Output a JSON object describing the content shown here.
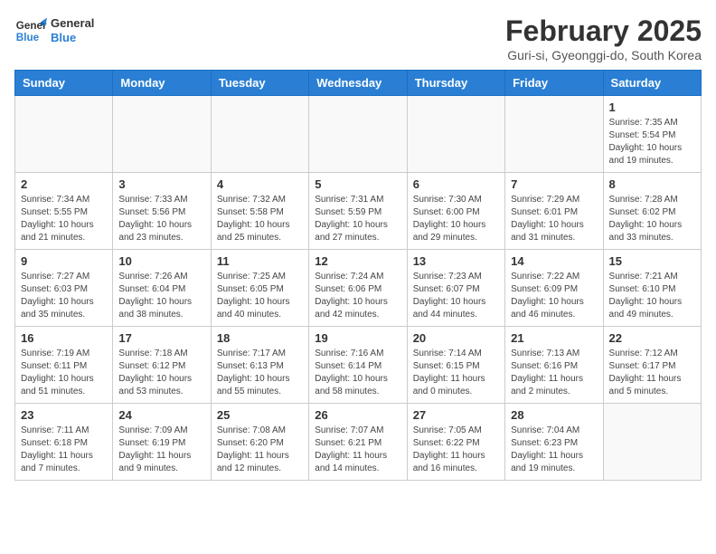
{
  "header": {
    "logo_line1": "General",
    "logo_line2": "Blue",
    "month_year": "February 2025",
    "location": "Guri-si, Gyeonggi-do, South Korea"
  },
  "weekdays": [
    "Sunday",
    "Monday",
    "Tuesday",
    "Wednesday",
    "Thursday",
    "Friday",
    "Saturday"
  ],
  "weeks": [
    [
      {
        "day": "",
        "info": ""
      },
      {
        "day": "",
        "info": ""
      },
      {
        "day": "",
        "info": ""
      },
      {
        "day": "",
        "info": ""
      },
      {
        "day": "",
        "info": ""
      },
      {
        "day": "",
        "info": ""
      },
      {
        "day": "1",
        "info": "Sunrise: 7:35 AM\nSunset: 5:54 PM\nDaylight: 10 hours\nand 19 minutes."
      }
    ],
    [
      {
        "day": "2",
        "info": "Sunrise: 7:34 AM\nSunset: 5:55 PM\nDaylight: 10 hours\nand 21 minutes."
      },
      {
        "day": "3",
        "info": "Sunrise: 7:33 AM\nSunset: 5:56 PM\nDaylight: 10 hours\nand 23 minutes."
      },
      {
        "day": "4",
        "info": "Sunrise: 7:32 AM\nSunset: 5:58 PM\nDaylight: 10 hours\nand 25 minutes."
      },
      {
        "day": "5",
        "info": "Sunrise: 7:31 AM\nSunset: 5:59 PM\nDaylight: 10 hours\nand 27 minutes."
      },
      {
        "day": "6",
        "info": "Sunrise: 7:30 AM\nSunset: 6:00 PM\nDaylight: 10 hours\nand 29 minutes."
      },
      {
        "day": "7",
        "info": "Sunrise: 7:29 AM\nSunset: 6:01 PM\nDaylight: 10 hours\nand 31 minutes."
      },
      {
        "day": "8",
        "info": "Sunrise: 7:28 AM\nSunset: 6:02 PM\nDaylight: 10 hours\nand 33 minutes."
      }
    ],
    [
      {
        "day": "9",
        "info": "Sunrise: 7:27 AM\nSunset: 6:03 PM\nDaylight: 10 hours\nand 35 minutes."
      },
      {
        "day": "10",
        "info": "Sunrise: 7:26 AM\nSunset: 6:04 PM\nDaylight: 10 hours\nand 38 minutes."
      },
      {
        "day": "11",
        "info": "Sunrise: 7:25 AM\nSunset: 6:05 PM\nDaylight: 10 hours\nand 40 minutes."
      },
      {
        "day": "12",
        "info": "Sunrise: 7:24 AM\nSunset: 6:06 PM\nDaylight: 10 hours\nand 42 minutes."
      },
      {
        "day": "13",
        "info": "Sunrise: 7:23 AM\nSunset: 6:07 PM\nDaylight: 10 hours\nand 44 minutes."
      },
      {
        "day": "14",
        "info": "Sunrise: 7:22 AM\nSunset: 6:09 PM\nDaylight: 10 hours\nand 46 minutes."
      },
      {
        "day": "15",
        "info": "Sunrise: 7:21 AM\nSunset: 6:10 PM\nDaylight: 10 hours\nand 49 minutes."
      }
    ],
    [
      {
        "day": "16",
        "info": "Sunrise: 7:19 AM\nSunset: 6:11 PM\nDaylight: 10 hours\nand 51 minutes."
      },
      {
        "day": "17",
        "info": "Sunrise: 7:18 AM\nSunset: 6:12 PM\nDaylight: 10 hours\nand 53 minutes."
      },
      {
        "day": "18",
        "info": "Sunrise: 7:17 AM\nSunset: 6:13 PM\nDaylight: 10 hours\nand 55 minutes."
      },
      {
        "day": "19",
        "info": "Sunrise: 7:16 AM\nSunset: 6:14 PM\nDaylight: 10 hours\nand 58 minutes."
      },
      {
        "day": "20",
        "info": "Sunrise: 7:14 AM\nSunset: 6:15 PM\nDaylight: 11 hours\nand 0 minutes."
      },
      {
        "day": "21",
        "info": "Sunrise: 7:13 AM\nSunset: 6:16 PM\nDaylight: 11 hours\nand 2 minutes."
      },
      {
        "day": "22",
        "info": "Sunrise: 7:12 AM\nSunset: 6:17 PM\nDaylight: 11 hours\nand 5 minutes."
      }
    ],
    [
      {
        "day": "23",
        "info": "Sunrise: 7:11 AM\nSunset: 6:18 PM\nDaylight: 11 hours\nand 7 minutes."
      },
      {
        "day": "24",
        "info": "Sunrise: 7:09 AM\nSunset: 6:19 PM\nDaylight: 11 hours\nand 9 minutes."
      },
      {
        "day": "25",
        "info": "Sunrise: 7:08 AM\nSunset: 6:20 PM\nDaylight: 11 hours\nand 12 minutes."
      },
      {
        "day": "26",
        "info": "Sunrise: 7:07 AM\nSunset: 6:21 PM\nDaylight: 11 hours\nand 14 minutes."
      },
      {
        "day": "27",
        "info": "Sunrise: 7:05 AM\nSunset: 6:22 PM\nDaylight: 11 hours\nand 16 minutes."
      },
      {
        "day": "28",
        "info": "Sunrise: 7:04 AM\nSunset: 6:23 PM\nDaylight: 11 hours\nand 19 minutes."
      },
      {
        "day": "",
        "info": ""
      }
    ]
  ]
}
